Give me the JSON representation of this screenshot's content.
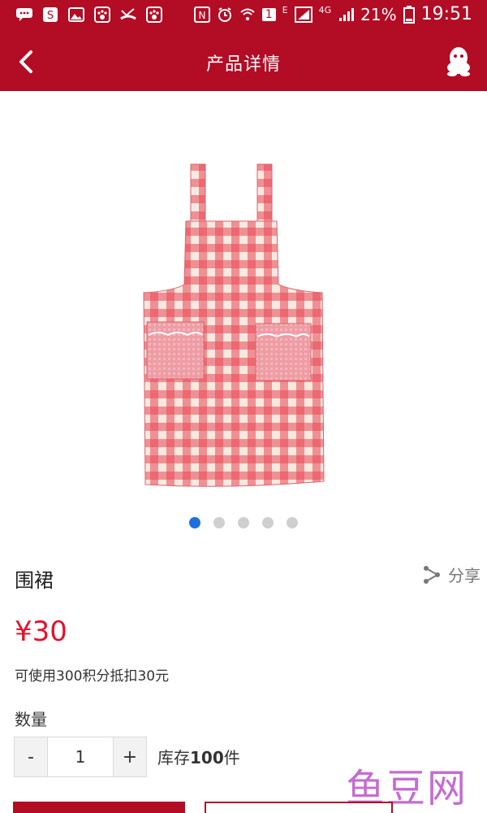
{
  "status_bar": {
    "network_label": "E",
    "network_small": "4G",
    "sim_label": "1",
    "battery_percent": "21%",
    "time": "19:51"
  },
  "header": {
    "title": "产品详情",
    "back_icon": "back-chevron-icon",
    "profile_icon": "qq-icon"
  },
  "carousel": {
    "active_index": 0,
    "dot_count": 5
  },
  "product": {
    "name": "围裙",
    "share_label": "分享",
    "price": "¥30",
    "points_text": "可使用300积分抵扣30元",
    "quantity_label": "数量",
    "minus": "-",
    "quantity": "1",
    "plus": "+",
    "stock_prefix": "库存",
    "stock_count": "100",
    "stock_suffix": "件"
  },
  "watermark": "鱼豆网",
  "colors": {
    "brand": "#b30c25",
    "price": "#e2122d",
    "dot_active": "#1f6fe0"
  }
}
